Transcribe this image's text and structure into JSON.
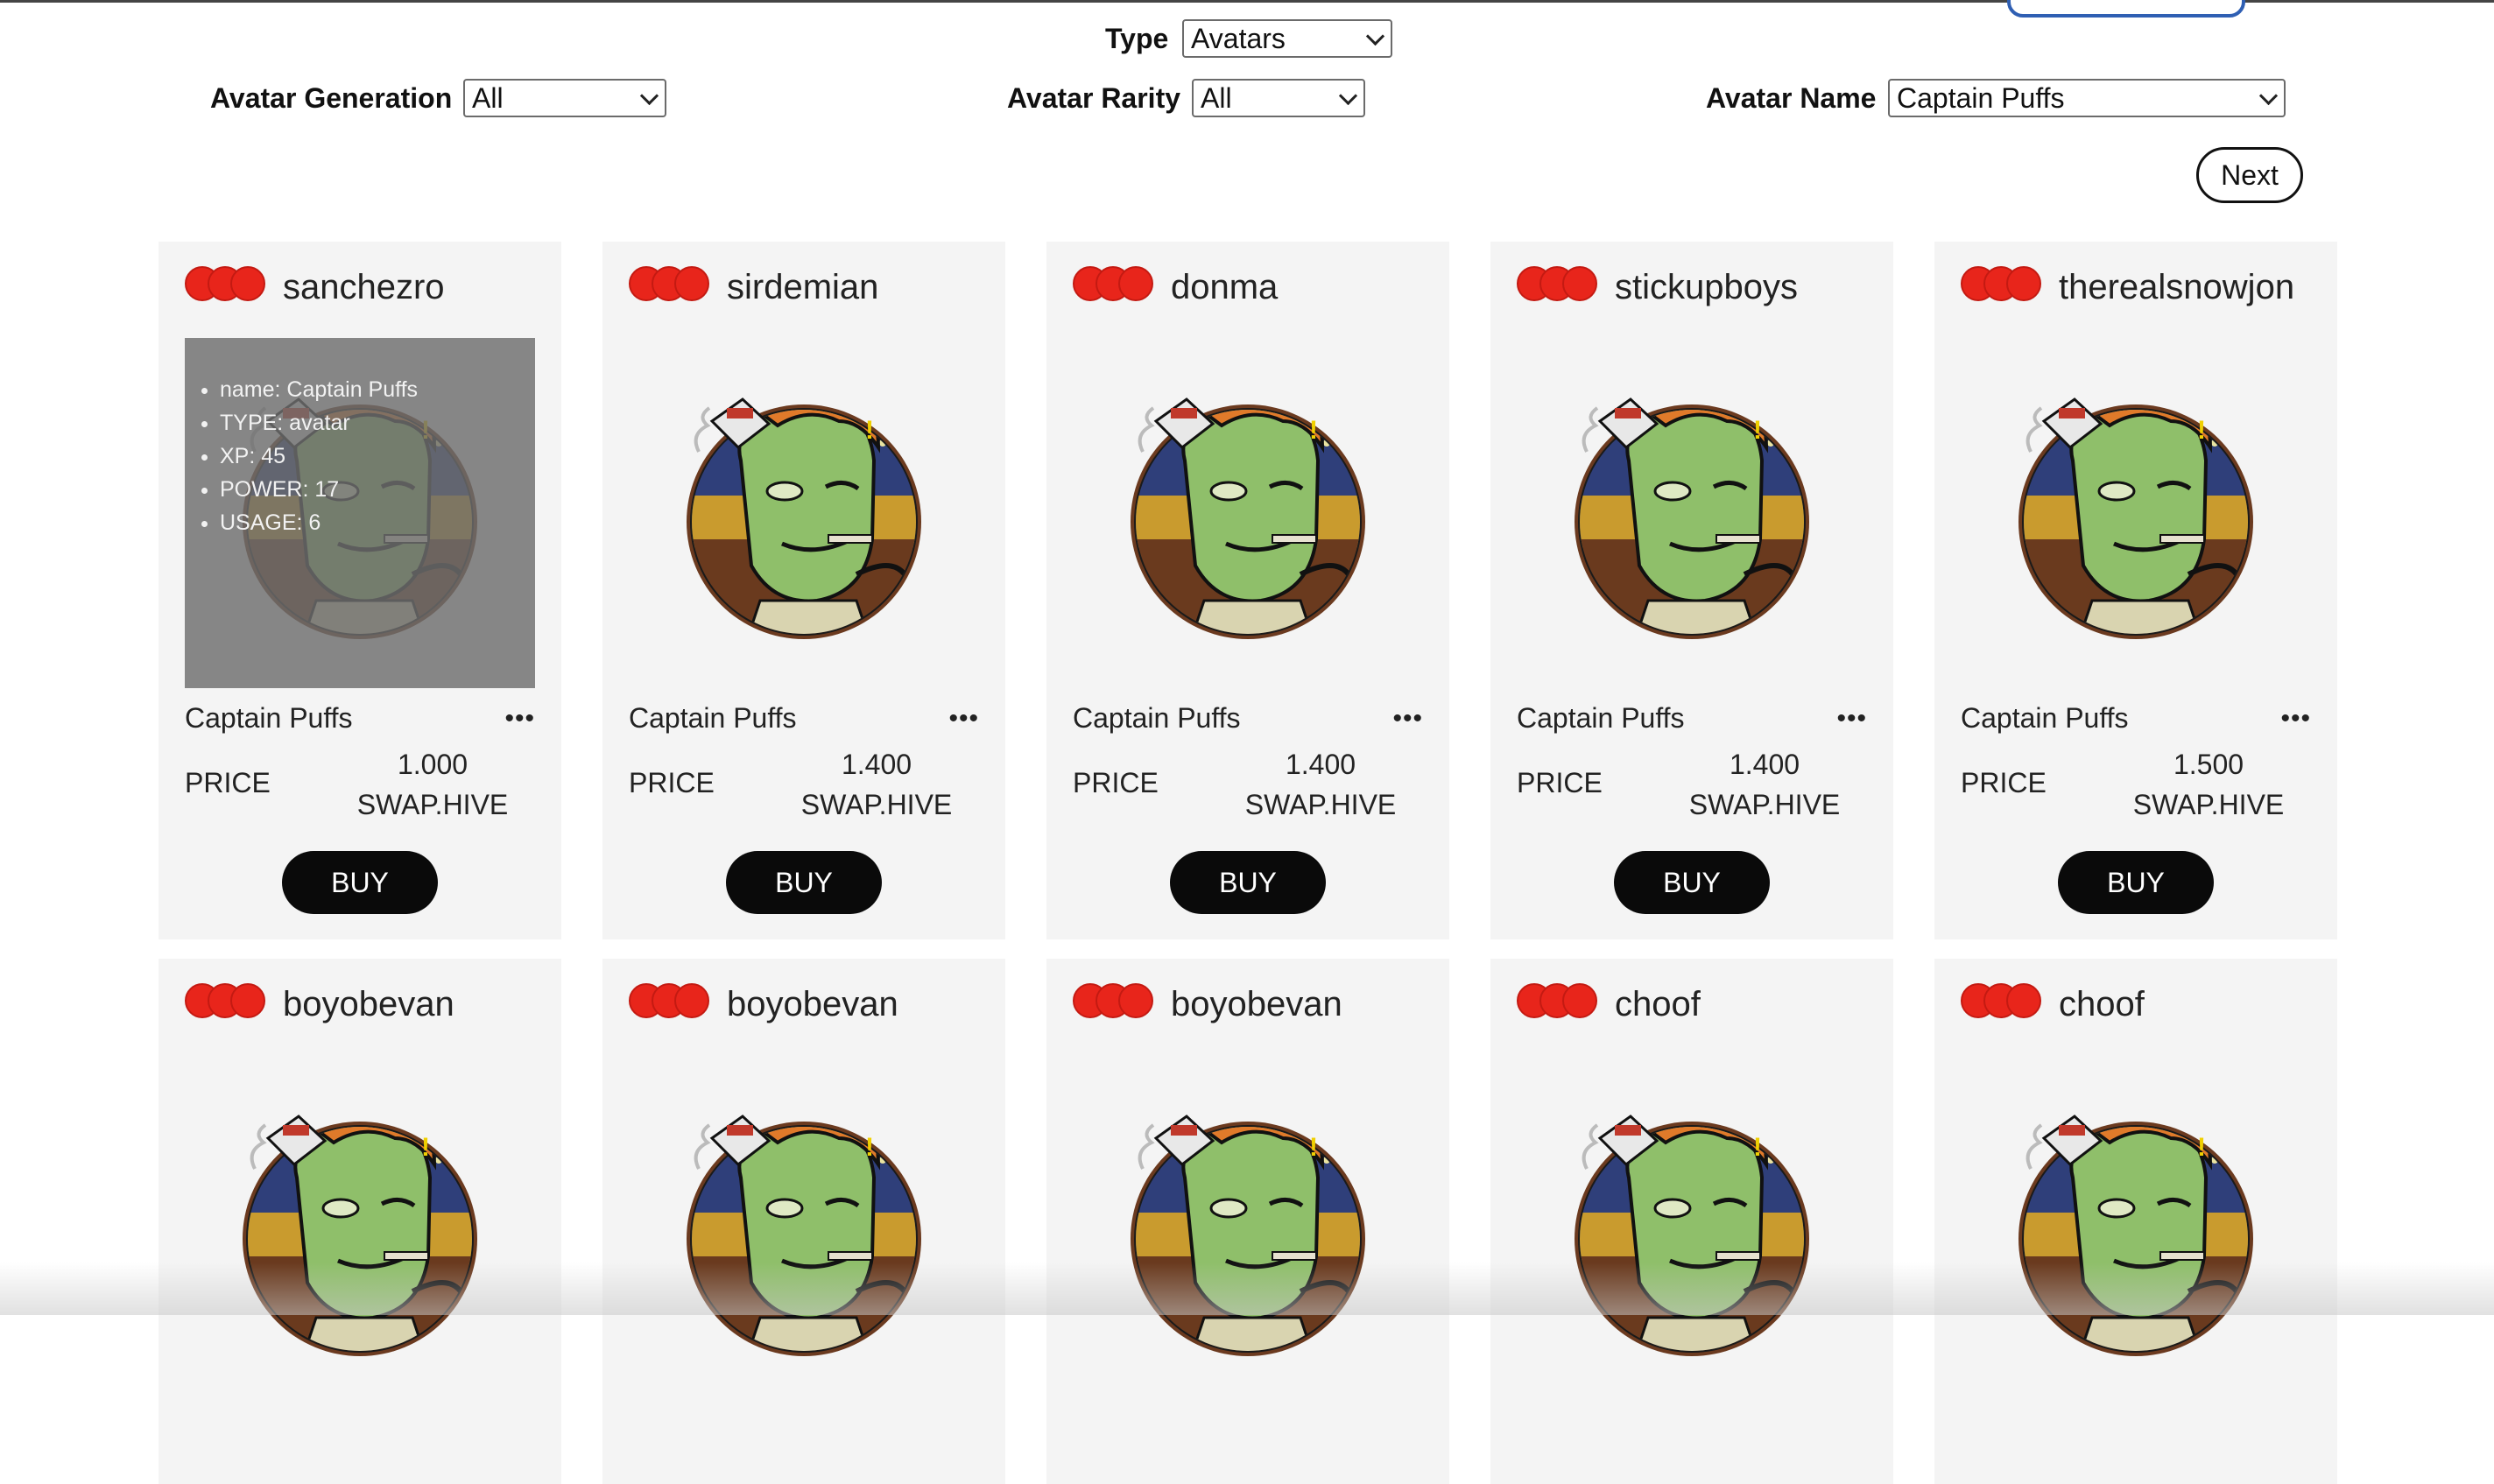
{
  "filters": {
    "type_label": "Type",
    "type_value": "Avatars",
    "generation_label": "Avatar Generation",
    "generation_value": "All",
    "rarity_label": "Avatar Rarity",
    "rarity_value": "All",
    "name_label": "Avatar Name",
    "name_value": "Captain Puffs"
  },
  "pagination": {
    "next_label": "Next"
  },
  "listing": {
    "price_label": "PRICE",
    "buy_label": "BUY",
    "more_label": "•••",
    "currency": "SWAP.HIVE"
  },
  "tooltip": {
    "items": [
      "name: Captain Puffs",
      "TYPE: avatar",
      "XP: 45",
      "POWER: 17",
      "USAGE: 6"
    ]
  },
  "cards": [
    {
      "seller": "sanchezro",
      "name": "Captain Puffs",
      "price": "1.000"
    },
    {
      "seller": "sirdemian",
      "name": "Captain Puffs",
      "price": "1.400"
    },
    {
      "seller": "donma",
      "name": "Captain Puffs",
      "price": "1.400"
    },
    {
      "seller": "stickupboys",
      "name": "Captain Puffs",
      "price": "1.400"
    },
    {
      "seller": "therealsnowjon",
      "name": "Captain Puffs",
      "price": "1.500"
    },
    {
      "seller": "boyobevan"
    },
    {
      "seller": "boyobevan"
    },
    {
      "seller": "boyobevan"
    },
    {
      "seller": "choof"
    },
    {
      "seller": "choof"
    }
  ],
  "colors": {
    "rarity_dot": "#e8251b",
    "card_bg": "#f4f4f4",
    "buy_bg": "#0a0a0a",
    "overlay": "#6e6e6e"
  }
}
